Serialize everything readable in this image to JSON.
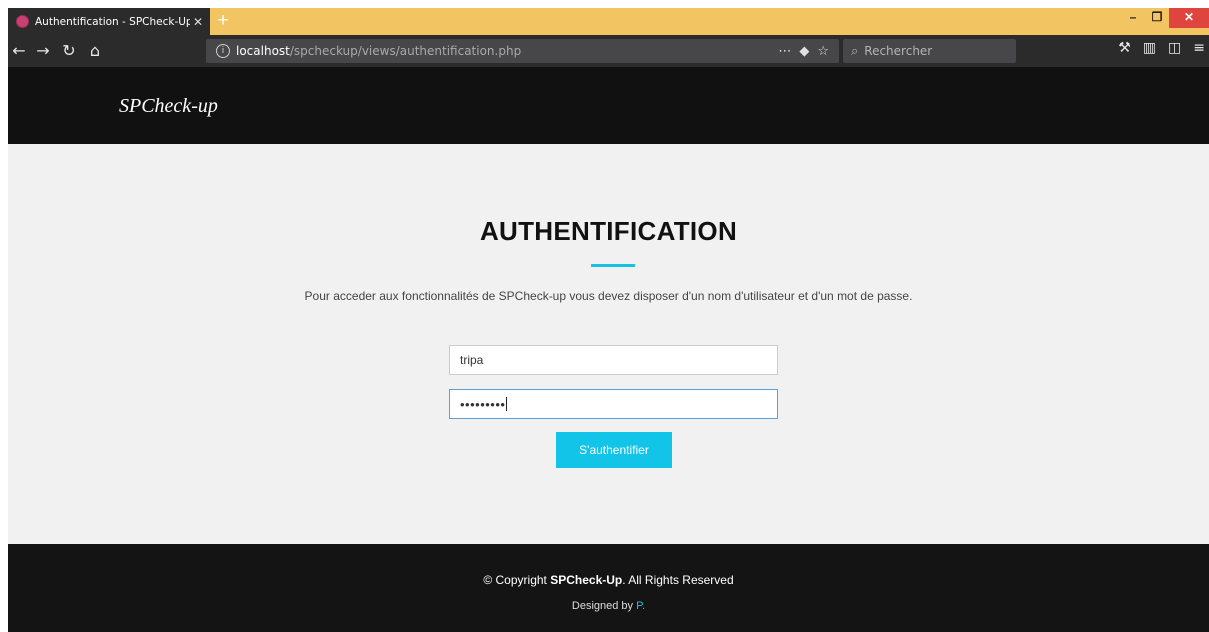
{
  "browser": {
    "tab_title": "Authentification - SPCheck-Up",
    "tab_close": "✕",
    "new_tab": "+",
    "url_host": "localhost",
    "url_path": "/spcheckup/views/authentification.php",
    "search_placeholder": "Rechercher"
  },
  "header": {
    "brand": "SPCheck-up"
  },
  "main": {
    "title": "AUTHENTIFICATION",
    "description": "Pour acceder aux fonctionnalités de SPCheck-up vous devez disposer d'un nom d'utilisateur et d'un mot de passe.",
    "username_value": "tripa",
    "password_value": "•••••••••",
    "login_button": "S'authentifier"
  },
  "footer": {
    "copyright_prefix": "© Copyright ",
    "copyright_brand": "SPCheck-Up",
    "copyright_suffix": ". All Rights Reserved",
    "designed_prefix": "Designed by ",
    "designer": "P."
  },
  "colors": {
    "accent": "#16c3e6",
    "header_bg": "#111111",
    "tabstrip": "#f2c462",
    "close_button": "#e0443e"
  }
}
